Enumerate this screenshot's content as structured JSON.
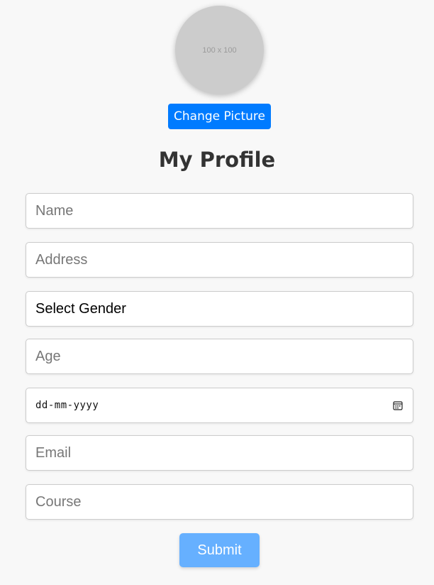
{
  "avatar": {
    "placeholder_text": "100 x 100"
  },
  "change_picture_label": "Change Picture",
  "page_title": "My Profile",
  "form": {
    "name_placeholder": "Name",
    "address_placeholder": "Address",
    "gender_selected": "Select Gender",
    "age_placeholder": "Age",
    "dob_placeholder": "dd-mm-yyyy",
    "email_placeholder": "Email",
    "course_placeholder": "Course",
    "submit_label": "Submit"
  },
  "icons": {
    "date_picker": "calendar-icon"
  },
  "colors": {
    "primary": "#007bff",
    "submit_disabled": "#66b0ff",
    "background": "#f8f8f8"
  }
}
